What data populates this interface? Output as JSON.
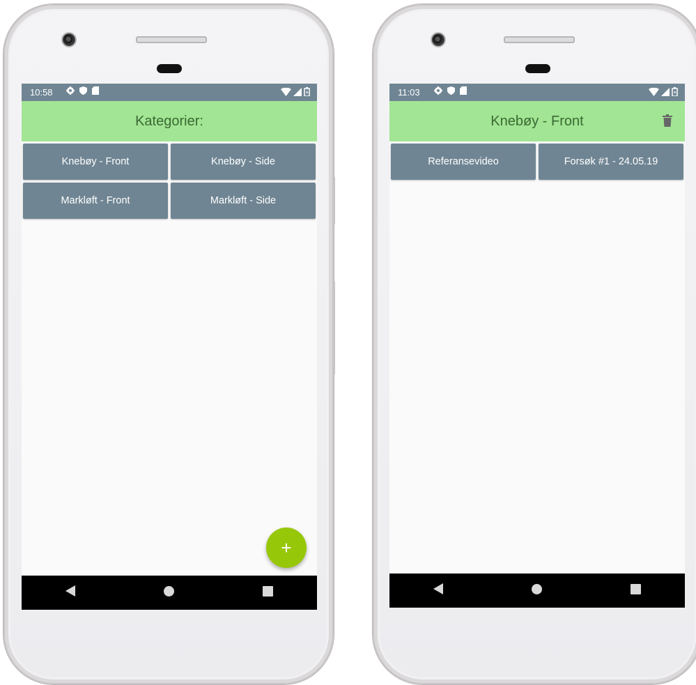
{
  "screens": [
    {
      "status_time": "10:58",
      "title": "Kategorier:",
      "tiles": [
        "Knebøy - Front",
        "Knebøy - Side",
        "Markløft - Front",
        "Markløft - Side"
      ],
      "fab_label": "+"
    },
    {
      "status_time": "11:03",
      "title": "Knebøy - Front",
      "tiles": [
        "Referansevideo",
        "Forsøk #1 - 24.05.19"
      ]
    }
  ],
  "colors": {
    "statusbar": "#6f8593",
    "appbar": "#a2e594",
    "tile": "#6f8593",
    "fab": "#97c709",
    "navbar": "#000000"
  },
  "icons": {
    "status": [
      "settings-icon",
      "shield-icon",
      "sd-card-icon",
      "wifi-icon",
      "signal-icon",
      "battery-icon"
    ],
    "nav": [
      "back-icon",
      "home-icon",
      "recents-icon"
    ],
    "appbar_action": "trash-icon"
  }
}
